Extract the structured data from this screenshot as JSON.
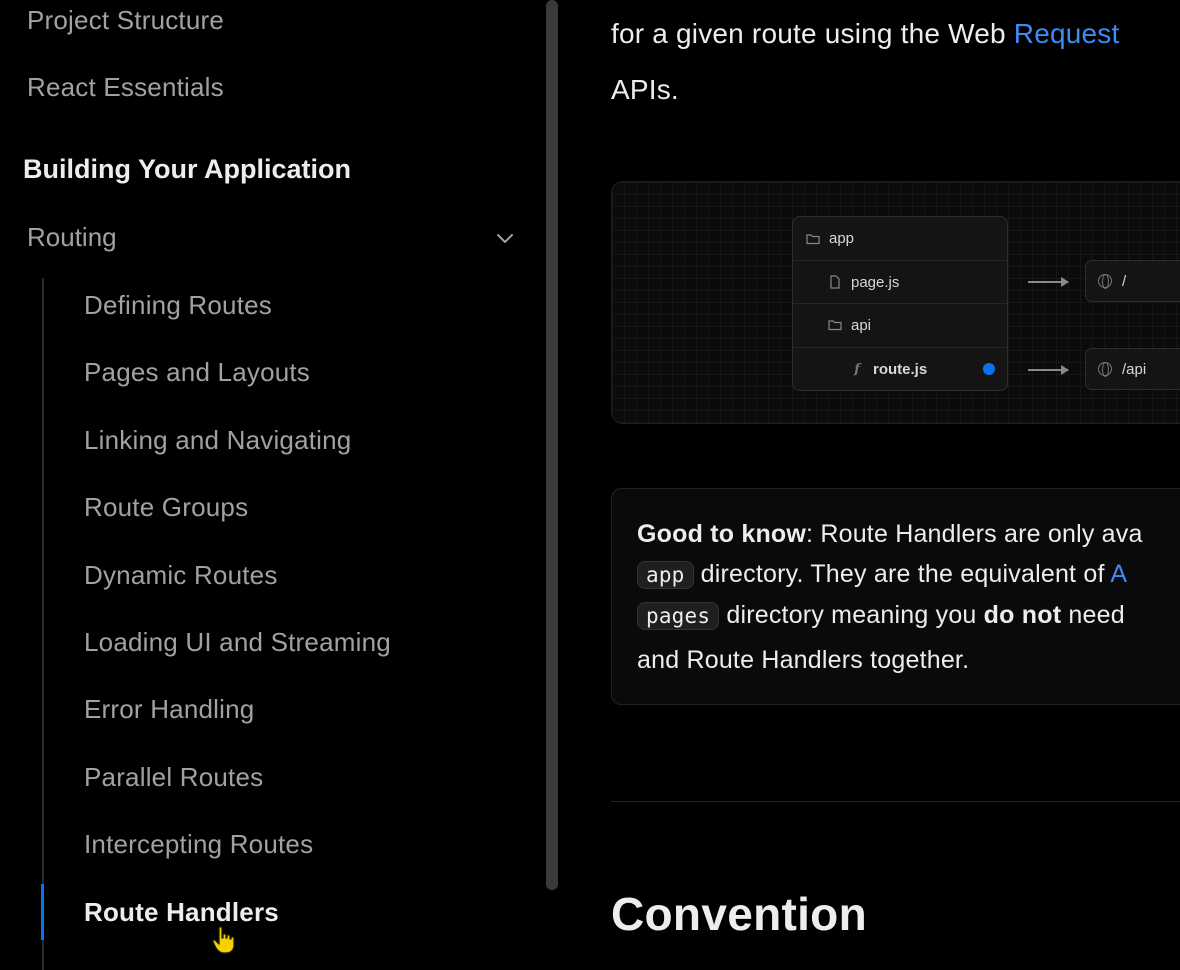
{
  "sidebar": {
    "top_items": [
      {
        "label": "Project Structure"
      },
      {
        "label": "React Essentials"
      }
    ],
    "section_heading": "Building Your Application",
    "group": {
      "label": "Routing",
      "expanded": true,
      "items": [
        {
          "label": "Defining Routes"
        },
        {
          "label": "Pages and Layouts"
        },
        {
          "label": "Linking and Navigating"
        },
        {
          "label": "Route Groups"
        },
        {
          "label": "Dynamic Routes"
        },
        {
          "label": "Loading UI and Streaming"
        },
        {
          "label": "Error Handling"
        },
        {
          "label": "Parallel Routes"
        },
        {
          "label": "Intercepting Routes"
        },
        {
          "label": "Route Handlers",
          "active": true
        }
      ]
    }
  },
  "main": {
    "lead": {
      "line1_text": "for a given route using the Web ",
      "line1_link": "Request",
      "line2_text": "APIs."
    },
    "diagram": {
      "files": [
        {
          "name": "app",
          "icon": "folder-icon"
        },
        {
          "name": "page.js",
          "icon": "file-icon"
        },
        {
          "name": "api",
          "icon": "folder-icon"
        },
        {
          "name": "route.js",
          "icon": "function-icon",
          "highlight": true
        }
      ],
      "routes": [
        {
          "path": "/"
        },
        {
          "path": "/api"
        }
      ]
    },
    "callout": {
      "label": "Good to know",
      "line1_rest": ": Route Handlers are only ava",
      "code1": "app",
      "line2_text": " directory. They are the equivalent of ",
      "line2_link": "A",
      "code2": "pages",
      "line3_text_a": " directory meaning you ",
      "line3_bold": "do not",
      "line3_text_b": " need",
      "line4_text": "and Route Handlers together."
    },
    "section_title": "Convention"
  },
  "colors": {
    "accent": "#0a72ef",
    "link": "#3b8cf5",
    "background": "#000000",
    "muted_text": "#a1a1a1"
  }
}
